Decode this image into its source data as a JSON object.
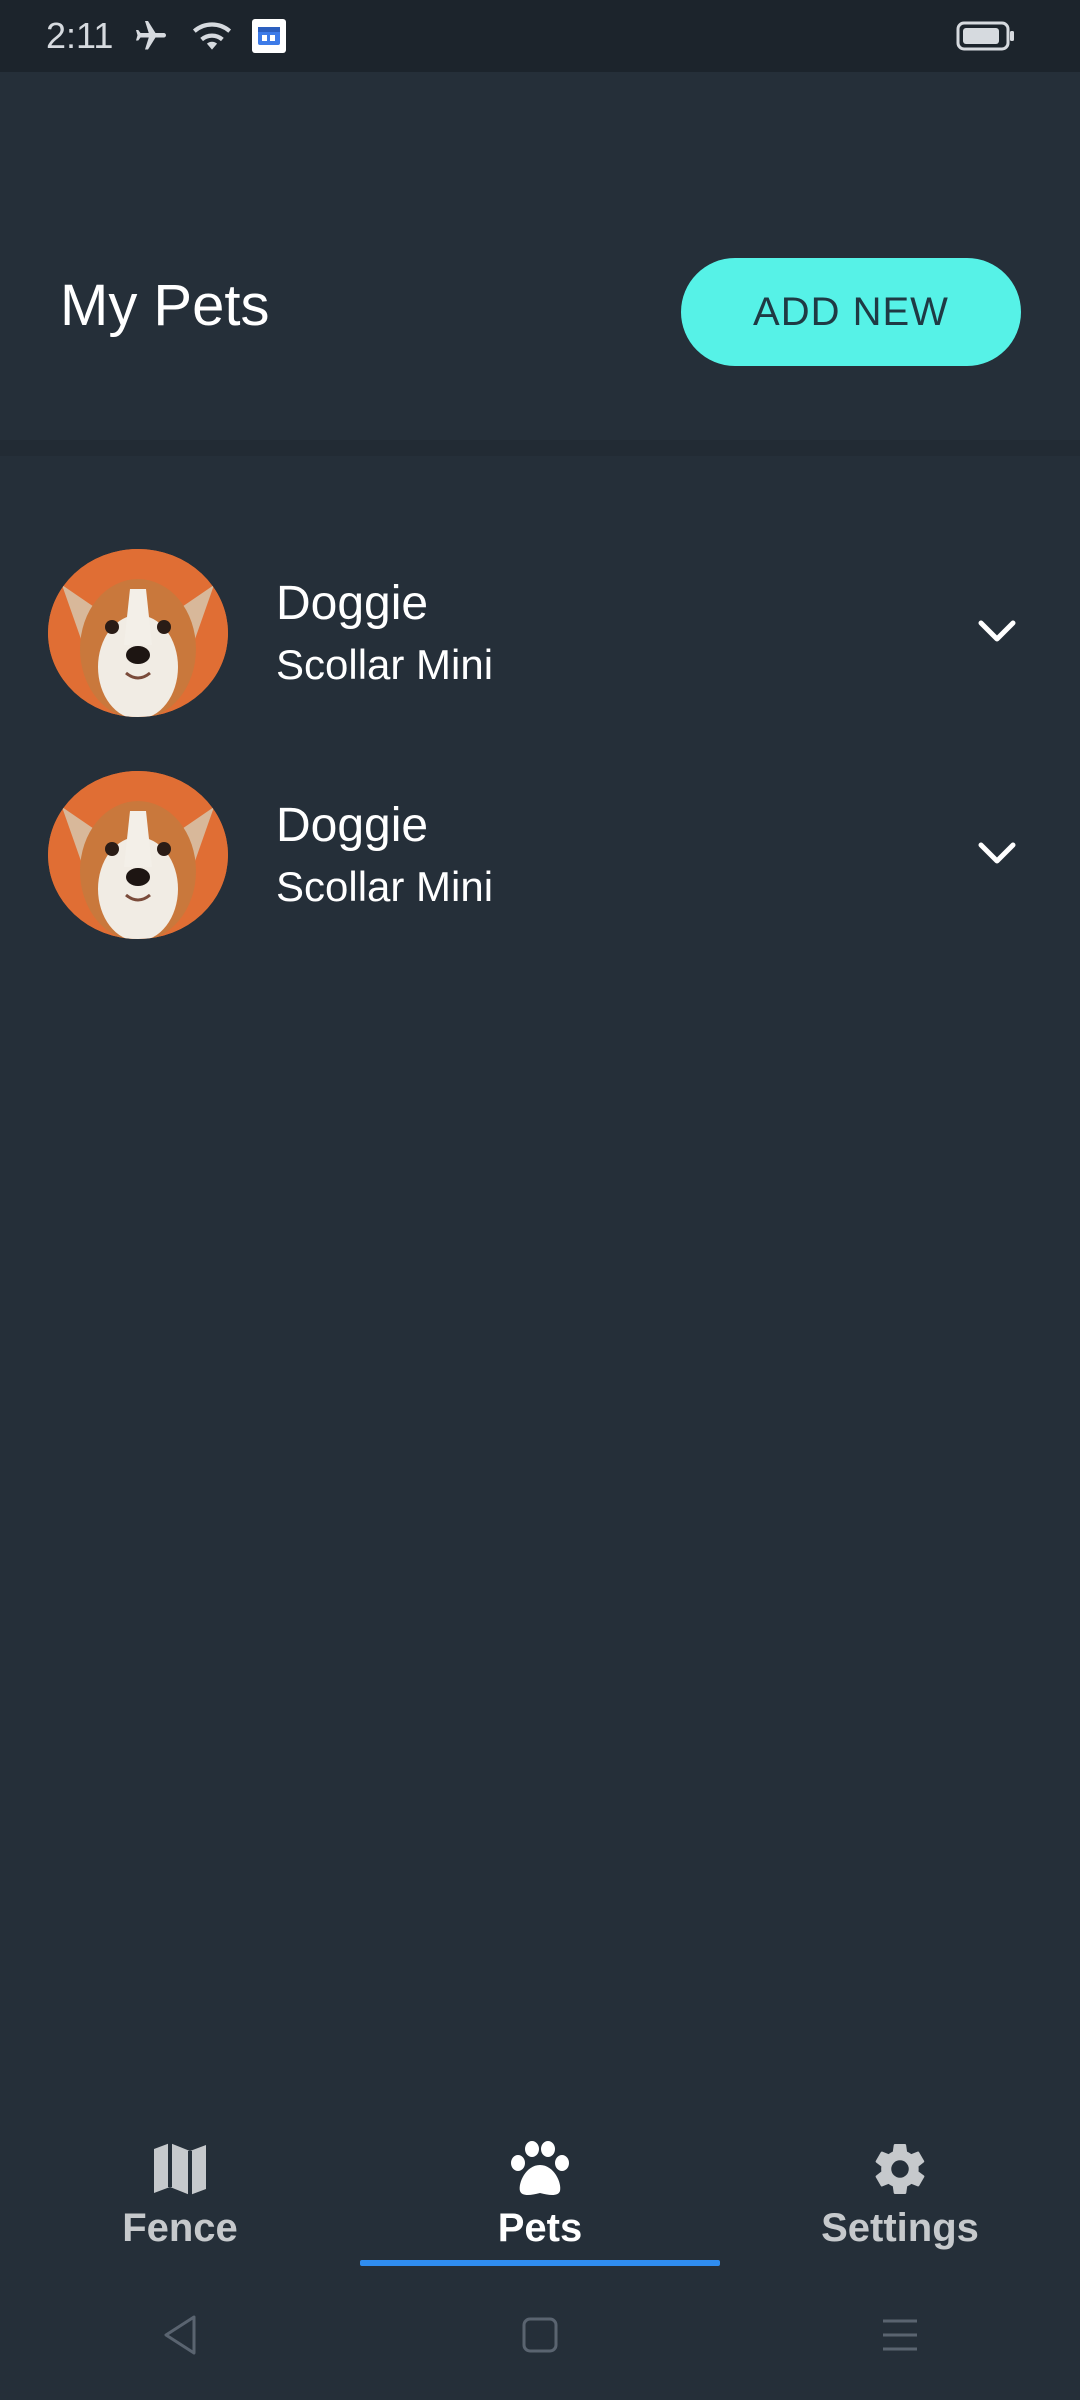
{
  "status_bar": {
    "time": "2:11",
    "icons": [
      "airplane-icon",
      "wifi-icon",
      "calendar-app-icon",
      "battery-icon"
    ]
  },
  "header": {
    "title": "My Pets",
    "add_button_label": "ADD NEW"
  },
  "pets": [
    {
      "name": "Doggie",
      "device": "Scollar Mini",
      "avatar": "corgi-photo",
      "expand_icon": "chevron-down-icon"
    },
    {
      "name": "Doggie",
      "device": "Scollar Mini",
      "avatar": "corgi-photo",
      "expand_icon": "chevron-down-icon"
    }
  ],
  "bottom_nav": {
    "tabs": [
      {
        "label": "Fence",
        "icon": "map-icon",
        "active": false
      },
      {
        "label": "Pets",
        "icon": "paw-icon",
        "active": true
      },
      {
        "label": "Settings",
        "icon": "gear-icon",
        "active": false
      }
    ]
  },
  "system_nav": {
    "buttons": [
      "back-icon",
      "home-icon",
      "recents-icon"
    ]
  },
  "colors": {
    "background": "#252f39",
    "status_bar": "#1c242c",
    "accent_button": "#56f2e7",
    "active_indicator": "#2f8df0",
    "avatar_bg": "#e06e34"
  }
}
